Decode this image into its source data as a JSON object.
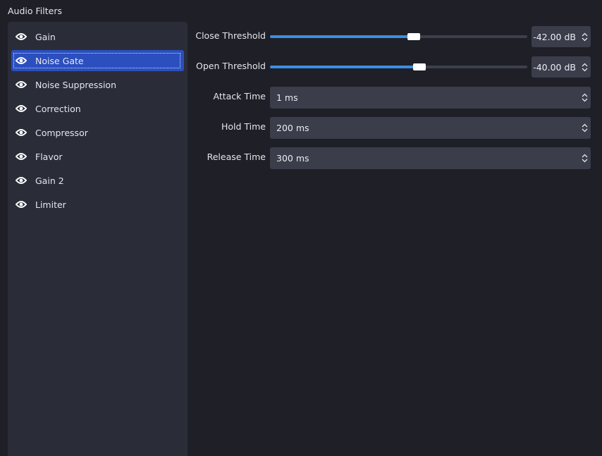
{
  "header": {
    "title": "Audio Filters"
  },
  "filters": [
    {
      "label": "Gain",
      "icon": "eye-icon"
    },
    {
      "label": "Noise Gate",
      "icon": "eye-icon",
      "selected": true
    },
    {
      "label": "Noise Suppression",
      "icon": "eye-icon"
    },
    {
      "label": "Correction",
      "icon": "eye-icon"
    },
    {
      "label": "Compressor",
      "icon": "eye-icon"
    },
    {
      "label": "Flavor",
      "icon": "eye-icon"
    },
    {
      "label": "Gain 2",
      "icon": "eye-icon"
    },
    {
      "label": "Limiter",
      "icon": "eye-icon"
    }
  ],
  "settings": {
    "close_threshold": {
      "label": "Close Threshold",
      "value": "-42.00 dB",
      "slider_fraction": 0.56
    },
    "open_threshold": {
      "label": "Open Threshold",
      "value": "-40.00 dB",
      "slider_fraction": 0.58
    },
    "attack_time": {
      "label": "Attack Time",
      "value": "1 ms"
    },
    "hold_time": {
      "label": "Hold Time",
      "value": "200 ms"
    },
    "release_time": {
      "label": "Release Time",
      "value": "300 ms"
    }
  },
  "colors": {
    "accent": "#3a8ee6",
    "selection": "#2b4fbf",
    "background": "#1e1f27",
    "panel": "#2a2c38",
    "field": "#3b3d4b"
  }
}
